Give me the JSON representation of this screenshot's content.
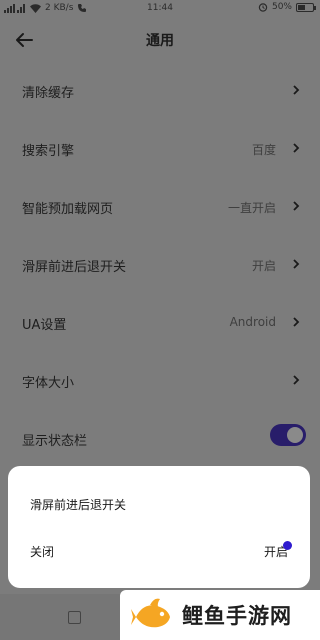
{
  "status_bar": {
    "signal_text": "2 KB/s",
    "time": "11:44",
    "battery_percent": "50%",
    "battery_level": 0.5
  },
  "header": {
    "title": "通用"
  },
  "settings": [
    {
      "label": "清除缓存",
      "value": ""
    },
    {
      "label": "搜索引擎",
      "value": "百度"
    },
    {
      "label": "智能预加载网页",
      "value": "一直开启"
    },
    {
      "label": "滑屏前进后退开关",
      "value": "开启"
    },
    {
      "label": "UA设置",
      "value": "Android"
    },
    {
      "label": "字体大小",
      "value": ""
    },
    {
      "label": "显示状态栏",
      "value": ""
    }
  ],
  "toggle": {
    "on": true,
    "color": "#281d6a"
  },
  "sheet": {
    "title": "滑屏前进后退开关",
    "options": [
      "关闭",
      "开启"
    ],
    "selected": "开启",
    "accent": "#2f1ccf"
  },
  "watermark": {
    "text": "鲤鱼手游网",
    "logo_color": "#f5a623"
  }
}
